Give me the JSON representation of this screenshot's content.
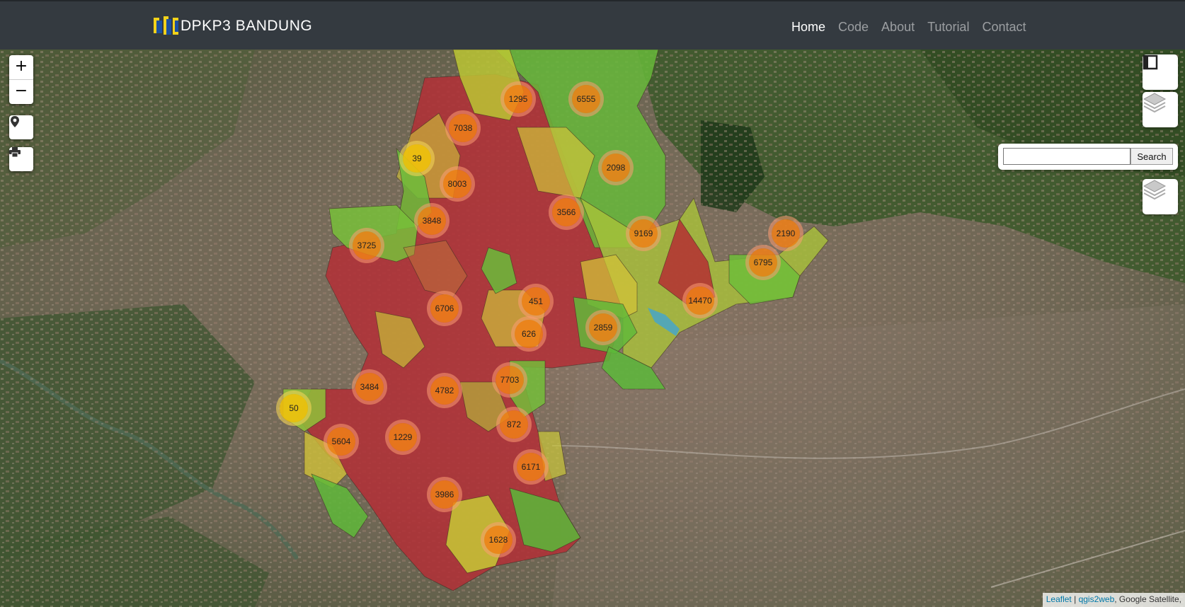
{
  "navbar": {
    "brand": "DPKP3 BANDUNG",
    "links": [
      {
        "label": "Home",
        "active": true
      },
      {
        "label": "Code",
        "active": false
      },
      {
        "label": "About",
        "active": false
      },
      {
        "label": "Tutorial",
        "active": false
      },
      {
        "label": "Contact",
        "active": false
      }
    ]
  },
  "controls": {
    "zoom_in": "+",
    "zoom_out": "−",
    "search": {
      "placeholder": "",
      "button_label": "Search"
    }
  },
  "clusters": [
    {
      "label": "1295",
      "color": "orange"
    },
    {
      "label": "6555",
      "color": "orange"
    },
    {
      "label": "7038",
      "color": "orange"
    },
    {
      "label": "39",
      "color": "yellow"
    },
    {
      "label": "2098",
      "color": "orange"
    },
    {
      "label": "8003",
      "color": "orange"
    },
    {
      "label": "3566",
      "color": "orange"
    },
    {
      "label": "3848",
      "color": "orange"
    },
    {
      "label": "9169",
      "color": "orange"
    },
    {
      "label": "2190",
      "color": "orange"
    },
    {
      "label": "3725",
      "color": "orange"
    },
    {
      "label": "6795",
      "color": "orange"
    },
    {
      "label": "451",
      "color": "orange"
    },
    {
      "label": "14470",
      "color": "orange"
    },
    {
      "label": "6706",
      "color": "orange"
    },
    {
      "label": "626",
      "color": "orange"
    },
    {
      "label": "2859",
      "color": "orange"
    },
    {
      "label": "7703",
      "color": "orange"
    },
    {
      "label": "3484",
      "color": "orange"
    },
    {
      "label": "4782",
      "color": "orange"
    },
    {
      "label": "50",
      "color": "yellow"
    },
    {
      "label": "872",
      "color": "orange"
    },
    {
      "label": "5604",
      "color": "orange"
    },
    {
      "label": "1229",
      "color": "orange"
    },
    {
      "label": "6171",
      "color": "orange"
    },
    {
      "label": "3986",
      "color": "orange"
    },
    {
      "label": "1628",
      "color": "orange"
    }
  ],
  "attribution": {
    "leaflet": "Leaflet",
    "sep": " | ",
    "qgis": "qgis2web",
    "rest": ", Google Satellite,"
  },
  "colors": {
    "navbar": "#343a40",
    "cluster_orange": "#f18017",
    "cluster_yellow": "#f0c20c",
    "zone_red": "#b5313a",
    "zone_green": "#5cb83a",
    "zone_yellow": "#c4c836"
  }
}
